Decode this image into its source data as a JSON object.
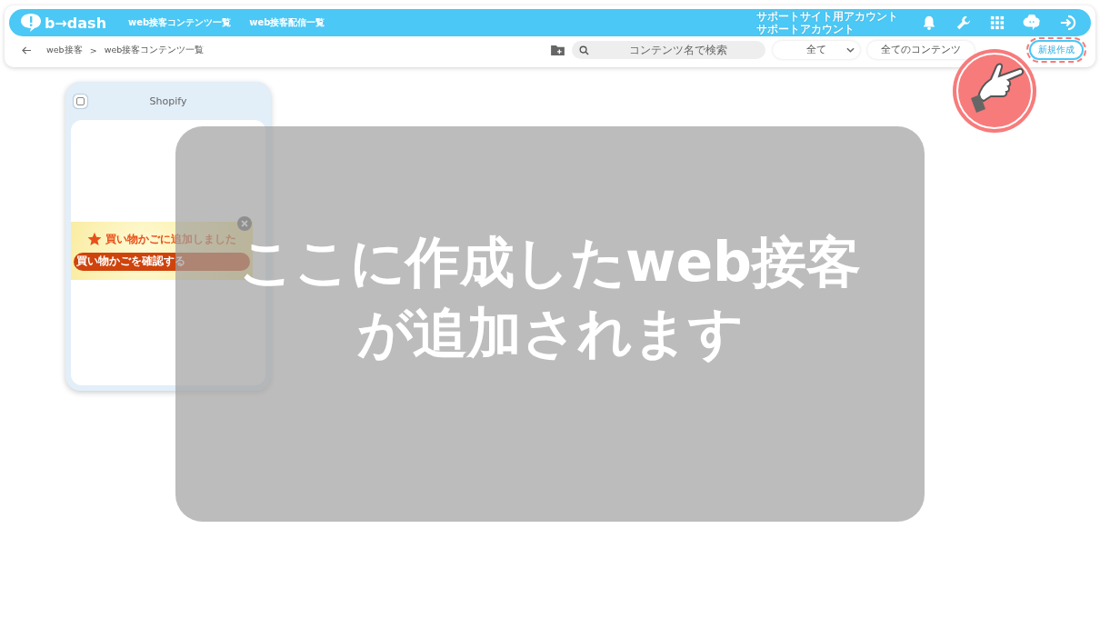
{
  "header": {
    "logo": "b→dash",
    "nav": [
      "web接客コンテンツ一覧",
      "web接客配信一覧"
    ],
    "account": [
      "サポートサイト用アカウント",
      "サポートアカウント"
    ]
  },
  "toolbar": {
    "breadcrumb": [
      "web接客",
      "web接客コンテンツ一覧"
    ],
    "separator": ">",
    "search": {
      "placeholder": "コンテンツ名で検索"
    },
    "filter": "全て",
    "content_filter": "全てのコンテンツ",
    "new_button": "新規作成"
  },
  "card": {
    "title": "Shopify",
    "checked": false,
    "popup": {
      "message": "買い物かごに追加しました",
      "button": "買い物かごを確認する"
    }
  },
  "overlay": {
    "lines": [
      "ここに作成したweb接客",
      "が追加されます"
    ]
  }
}
